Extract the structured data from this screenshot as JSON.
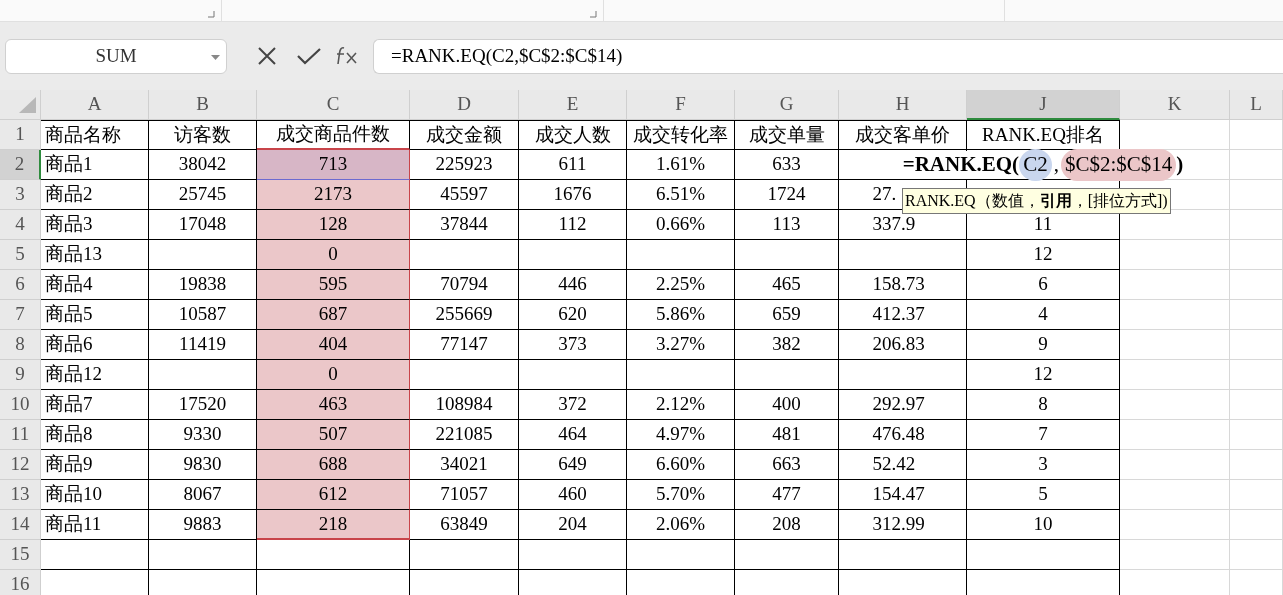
{
  "name_box": {
    "value": "SUM"
  },
  "formula_bar": {
    "value": "=RANK.EQ(C2,$C$2:$C$14)"
  },
  "columns": [
    {
      "label": "A",
      "selected": false
    },
    {
      "label": "B",
      "selected": false
    },
    {
      "label": "C",
      "selected": false
    },
    {
      "label": "D",
      "selected": false
    },
    {
      "label": "E",
      "selected": false
    },
    {
      "label": "F",
      "selected": false
    },
    {
      "label": "G",
      "selected": false
    },
    {
      "label": "H",
      "selected": false
    },
    {
      "label": "J",
      "selected": true
    },
    {
      "label": "K",
      "selected": false
    },
    {
      "label": "L",
      "selected": false
    }
  ],
  "rows": [
    {
      "number": "1",
      "selected": false,
      "highlighted": false,
      "cells": [
        "商品名称",
        "访客数",
        "成交商品件数",
        "成交金额",
        "成交人数",
        "成交转化率",
        "成交单量",
        "成交客单价",
        "RANK.EQ排名"
      ]
    },
    {
      "number": "2",
      "selected": true,
      "highlighted": true,
      "cells": [
        "商品1",
        "38042",
        "713",
        "225923",
        "611",
        "1.61%",
        "633",
        null,
        null
      ]
    },
    {
      "number": "3",
      "selected": false,
      "highlighted": true,
      "cells": [
        "商品2",
        "25745",
        "2173",
        "45597",
        "1676",
        "6.51%",
        "1724",
        "27.",
        null
      ]
    },
    {
      "number": "4",
      "selected": false,
      "highlighted": true,
      "cells": [
        "商品3",
        "17048",
        "128",
        "37844",
        "112",
        "0.66%",
        "113",
        "337.9",
        "11"
      ]
    },
    {
      "number": "5",
      "selected": false,
      "highlighted": true,
      "cells": [
        "商品13",
        null,
        "0",
        null,
        null,
        null,
        null,
        null,
        "12"
      ]
    },
    {
      "number": "6",
      "selected": false,
      "highlighted": true,
      "cells": [
        "商品4",
        "19838",
        "595",
        "70794",
        "446",
        "2.25%",
        "465",
        "158.73",
        "6"
      ]
    },
    {
      "number": "7",
      "selected": false,
      "highlighted": true,
      "cells": [
        "商品5",
        "10587",
        "687",
        "255669",
        "620",
        "5.86%",
        "659",
        "412.37",
        "4"
      ]
    },
    {
      "number": "8",
      "selected": false,
      "highlighted": true,
      "cells": [
        "商品6",
        "11419",
        "404",
        "77147",
        "373",
        "3.27%",
        "382",
        "206.83",
        "9"
      ]
    },
    {
      "number": "9",
      "selected": false,
      "highlighted": true,
      "cells": [
        "商品12",
        null,
        "0",
        null,
        null,
        null,
        null,
        null,
        "12"
      ]
    },
    {
      "number": "10",
      "selected": false,
      "highlighted": true,
      "cells": [
        "商品7",
        "17520",
        "463",
        "108984",
        "372",
        "2.12%",
        "400",
        "292.97",
        "8"
      ]
    },
    {
      "number": "11",
      "selected": false,
      "highlighted": true,
      "cells": [
        "商品8",
        "9330",
        "507",
        "221085",
        "464",
        "4.97%",
        "481",
        "476.48",
        "7"
      ]
    },
    {
      "number": "12",
      "selected": false,
      "highlighted": true,
      "cells": [
        "商品9",
        "9830",
        "688",
        "34021",
        "649",
        "6.60%",
        "663",
        "52.42",
        "3"
      ]
    },
    {
      "number": "13",
      "selected": false,
      "highlighted": true,
      "cells": [
        "商品10",
        "8067",
        "612",
        "71057",
        "460",
        "5.70%",
        "477",
        "154.47",
        "5"
      ]
    },
    {
      "number": "14",
      "selected": false,
      "highlighted": true,
      "cells": [
        "商品11",
        "9883",
        "218",
        "63849",
        "204",
        "2.06%",
        "208",
        "312.99",
        "10"
      ]
    },
    {
      "number": "15",
      "selected": false,
      "highlighted": false
    },
    {
      "number": "16",
      "selected": false,
      "highlighted": false
    }
  ],
  "cell_editor": {
    "parts": [
      {
        "kind": "function",
        "text": "=RANK.EQ("
      },
      {
        "kind": "ref",
        "text": "C2",
        "color": "#c9d6ee"
      },
      {
        "kind": "separator",
        "text": ","
      },
      {
        "kind": "ref",
        "text": "$C$2:$C$14",
        "color": "#ebc6c8"
      },
      {
        "kind": "function",
        "text": ")"
      }
    ]
  },
  "tooltip": {
    "text": "RANK.EQ（数值，**引用**，[排位方式])"
  }
}
